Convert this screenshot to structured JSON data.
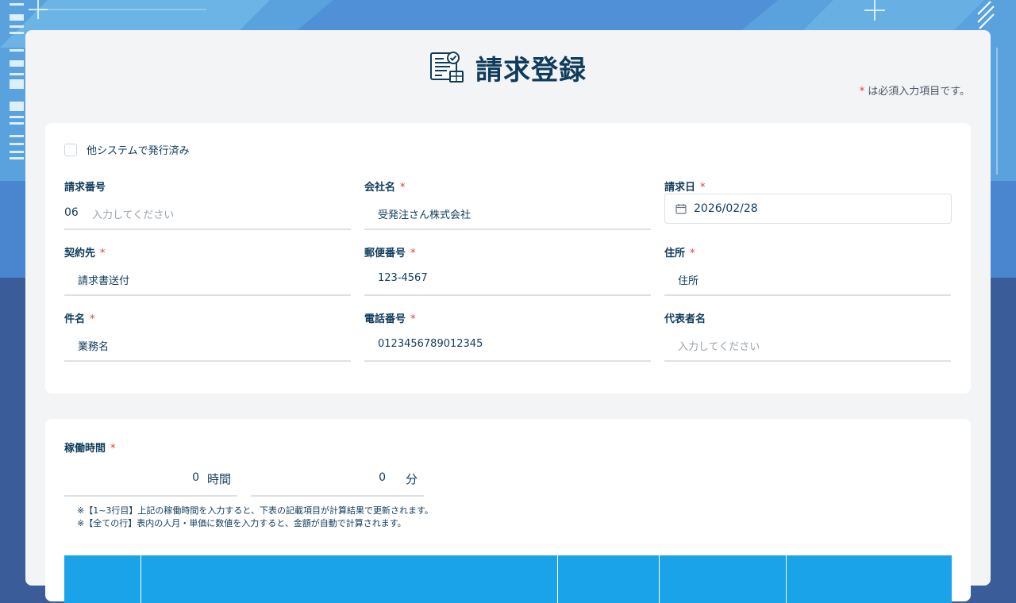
{
  "page": {
    "title": "請求登録",
    "required_note": "は必須入力項目です。",
    "required_mark": "*"
  },
  "issued_elsewhere": {
    "label": "他システムで発行済み",
    "checked": false
  },
  "fields": {
    "invoice_number": {
      "label": "請求番号",
      "prefix": "06",
      "placeholder": "入力してください",
      "required": false
    },
    "company_name": {
      "label": "会社名",
      "value": "受発注さん株式会社",
      "required": true
    },
    "invoice_date": {
      "label": "請求日",
      "value": "2026/02/28",
      "required": true
    },
    "contractor": {
      "label": "契約先",
      "value": "請求書送付",
      "required": true
    },
    "postal_code": {
      "label": "郵便番号",
      "value": "123-4567",
      "required": true
    },
    "address": {
      "label": "住所",
      "value": "住所",
      "required": true
    },
    "subject": {
      "label": "件名",
      "value": "業務名",
      "required": true
    },
    "phone": {
      "label": "電話番号",
      "value": "0123456789012345",
      "required": true
    },
    "representative": {
      "label": "代表者名",
      "placeholder": "入力してください",
      "required": false
    }
  },
  "working_hours": {
    "label": "稼働時間",
    "hours_value": "0",
    "hours_unit": "時間",
    "minutes_value": "0",
    "minutes_unit": "分",
    "note1": "※【1~3行目】上記の稼働時間を入力すると、下表の記載項目が計算結果で更新されます。",
    "note2": "※【全ての行】表内の人月・単価に数値を入力すると、金額が自動で計算されます。"
  },
  "colors": {
    "accent": "#1aa3e8",
    "text": "#0f3c5c",
    "required": "#e23b3b",
    "card_bg": "#f3f4f6"
  }
}
